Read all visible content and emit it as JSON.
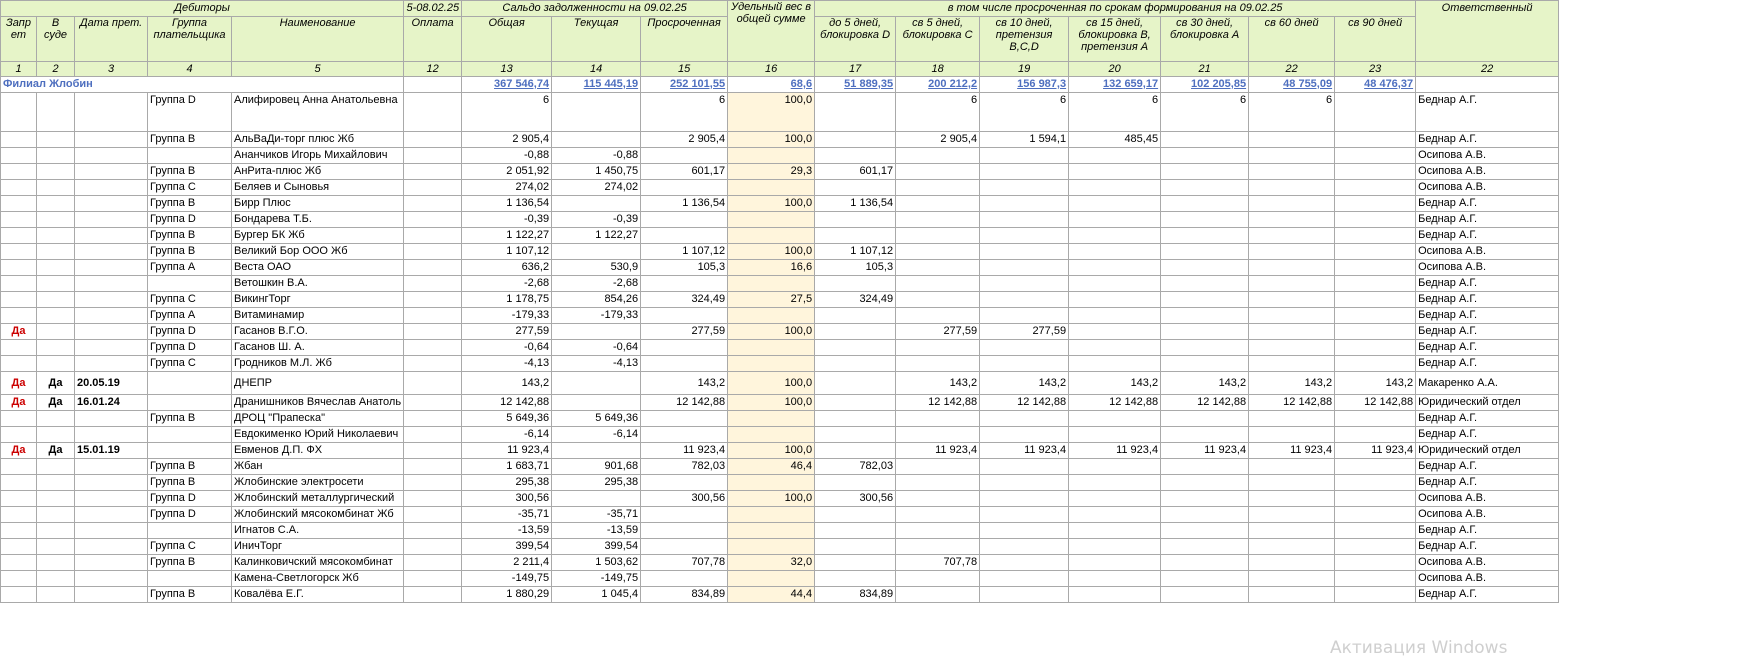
{
  "header": {
    "debitors": "Дебиторы",
    "payment_period": "5-08.02.25",
    "saldo": "Сальдо задолженности на 09.02.25",
    "weight": "Удельный вес в общей сумме",
    "overdue_terms": "в том числе просроченная по срокам формирования на 09.02.25",
    "responsible": "Ответственный"
  },
  "columns": {
    "ban": "Запр ет",
    "court": "В суде",
    "claim_date": "Дата прет.",
    "payer_group": "Группа плательщика",
    "name": "Наименование",
    "payment": "Оплата",
    "total": "Общая",
    "current": "Текущая",
    "overdue": "Просроченная",
    "d5": "до 5 дней, блокировка D",
    "o5": "св 5 дней, блокировка С",
    "o10": "св 10 дней, претензия В,С,D",
    "o15": "св 15 дней, блокировка В, претензия А",
    "o30": "св 30 дней, блокировка А",
    "o60": "св 60 дней",
    "o90": "св 90 дней"
  },
  "col_numbers": [
    "1",
    "2",
    "3",
    "4",
    "5",
    "12",
    "13",
    "14",
    "15",
    "16",
    "17",
    "18",
    "19",
    "20",
    "21",
    "22",
    "23",
    "22"
  ],
  "branch": {
    "name": "Филиал Жлобин",
    "total": "367 546,74",
    "current": "115 445,19",
    "overdue": "252 101,55",
    "weight": "68,6",
    "d5": "51 889,35",
    "o5": "200 212,2",
    "o10": "156 987,3",
    "o15": "132 659,17",
    "o30": "102 205,85",
    "o60": "48 755,09",
    "o90": "48 476,37"
  },
  "rows": [
    {
      "ban": "",
      "court": "",
      "date": "",
      "group": "Группа D",
      "name": "Алифировец Анна Анатольевна",
      "total": "6",
      "current": "",
      "overdue": "6",
      "weight": "100,0",
      "d5": "",
      "o5": "6",
      "o10": "6",
      "o15": "6",
      "o30": "6",
      "o60": "6",
      "o90": "",
      "resp": "Беднар А.Г.",
      "h": "tall"
    },
    {
      "ban": "",
      "court": "",
      "date": "",
      "group": "Группа В",
      "name": "АльВаДи-торг плюс Жб",
      "total": "2 905,4",
      "current": "",
      "overdue": "2 905,4",
      "weight": "100,0",
      "d5": "",
      "o5": "2 905,4",
      "o10": "1 594,1",
      "o15": "485,45",
      "o30": "",
      "o60": "",
      "o90": "",
      "resp": "Беднар А.Г."
    },
    {
      "ban": "",
      "court": "",
      "date": "",
      "group": "",
      "name": "Ананчиков Игорь Михайлович",
      "total": "-0,88",
      "current": "-0,88",
      "overdue": "",
      "weight": "",
      "d5": "",
      "o5": "",
      "o10": "",
      "o15": "",
      "o30": "",
      "o60": "",
      "o90": "",
      "resp": "Осипова А.В."
    },
    {
      "ban": "",
      "court": "",
      "date": "",
      "group": "Группа В",
      "name": "АнРита-плюс Жб",
      "total": "2 051,92",
      "current": "1 450,75",
      "overdue": "601,17",
      "weight": "29,3",
      "d5": "601,17",
      "o5": "",
      "o10": "",
      "o15": "",
      "o30": "",
      "o60": "",
      "o90": "",
      "resp": "Осипова А.В."
    },
    {
      "ban": "",
      "court": "",
      "date": "",
      "group": "Группа С",
      "name": "Беляев и Сыновья",
      "total": "274,02",
      "current": "274,02",
      "overdue": "",
      "weight": "",
      "d5": "",
      "o5": "",
      "o10": "",
      "o15": "",
      "o30": "",
      "o60": "",
      "o90": "",
      "resp": "Осипова А.В."
    },
    {
      "ban": "",
      "court": "",
      "date": "",
      "group": "Группа В",
      "name": "Бирр Плюс",
      "total": "1 136,54",
      "current": "",
      "overdue": "1 136,54",
      "weight": "100,0",
      "d5": "1 136,54",
      "o5": "",
      "o10": "",
      "o15": "",
      "o30": "",
      "o60": "",
      "o90": "",
      "resp": "Беднар А.Г."
    },
    {
      "ban": "",
      "court": "",
      "date": "",
      "group": "Группа D",
      "name": "Бондарева Т.Б.",
      "total": "-0,39",
      "current": "-0,39",
      "overdue": "",
      "weight": "",
      "d5": "",
      "o5": "",
      "o10": "",
      "o15": "",
      "o30": "",
      "o60": "",
      "o90": "",
      "resp": "Беднар А.Г."
    },
    {
      "ban": "",
      "court": "",
      "date": "",
      "group": "Группа В",
      "name": "Бургер БК Жб",
      "total": "1 122,27",
      "current": "1 122,27",
      "overdue": "",
      "weight": "",
      "d5": "",
      "o5": "",
      "o10": "",
      "o15": "",
      "o30": "",
      "o60": "",
      "o90": "",
      "resp": "Беднар А.Г."
    },
    {
      "ban": "",
      "court": "",
      "date": "",
      "group": "Группа В",
      "name": "Великий Бор  ООО Жб",
      "total": "1 107,12",
      "current": "",
      "overdue": "1 107,12",
      "weight": "100,0",
      "d5": "1 107,12",
      "o5": "",
      "o10": "",
      "o15": "",
      "o30": "",
      "o60": "",
      "o90": "",
      "resp": "Осипова А.В."
    },
    {
      "ban": "",
      "court": "",
      "date": "",
      "group": "Группа А",
      "name": "Веста ОАО",
      "total": "636,2",
      "current": "530,9",
      "overdue": "105,3",
      "weight": "16,6",
      "d5": "105,3",
      "o5": "",
      "o10": "",
      "o15": "",
      "o30": "",
      "o60": "",
      "o90": "",
      "resp": "Осипова А.В."
    },
    {
      "ban": "",
      "court": "",
      "date": "",
      "group": "",
      "name": "Ветошкин В.А.",
      "total": "-2,68",
      "current": "-2,68",
      "overdue": "",
      "weight": "",
      "d5": "",
      "o5": "",
      "o10": "",
      "o15": "",
      "o30": "",
      "o60": "",
      "o90": "",
      "resp": "Беднар А.Г."
    },
    {
      "ban": "",
      "court": "",
      "date": "",
      "group": "Группа С",
      "name": "ВикингТорг",
      "total": "1 178,75",
      "current": "854,26",
      "overdue": "324,49",
      "weight": "27,5",
      "d5": "324,49",
      "o5": "",
      "o10": "",
      "o15": "",
      "o30": "",
      "o60": "",
      "o90": "",
      "resp": "Беднар А.Г."
    },
    {
      "ban": "",
      "court": "",
      "date": "",
      "group": "Группа А",
      "name": "Витаминамир",
      "total": "-179,33",
      "current": "-179,33",
      "overdue": "",
      "weight": "",
      "d5": "",
      "o5": "",
      "o10": "",
      "o15": "",
      "o30": "",
      "o60": "",
      "o90": "",
      "resp": "Беднар А.Г."
    },
    {
      "ban": "Да",
      "court": "",
      "date": "",
      "group": "Группа D",
      "name": "Гасанов В.Г.О.",
      "total": "277,59",
      "current": "",
      "overdue": "277,59",
      "weight": "100,0",
      "d5": "",
      "o5": "277,59",
      "o10": "277,59",
      "o15": "",
      "o30": "",
      "o60": "",
      "o90": "",
      "resp": "Беднар А.Г."
    },
    {
      "ban": "",
      "court": "",
      "date": "",
      "group": "Группа D",
      "name": "Гасанов Ш. А.",
      "total": "-0,64",
      "current": "-0,64",
      "overdue": "",
      "weight": "",
      "d5": "",
      "o5": "",
      "o10": "",
      "o15": "",
      "o30": "",
      "o60": "",
      "o90": "",
      "resp": "Беднар А.Г."
    },
    {
      "ban": "",
      "court": "",
      "date": "",
      "group": "Группа С",
      "name": "Гродников М.Л. Жб",
      "total": "-4,13",
      "current": "-4,13",
      "overdue": "",
      "weight": "",
      "d5": "",
      "o5": "",
      "o10": "",
      "o15": "",
      "o30": "",
      "o60": "",
      "o90": "",
      "resp": "Беднар А.Г."
    },
    {
      "ban": "Да",
      "court": "Да",
      "date": "20.05.19",
      "group": "",
      "name": "ДНЕПР",
      "total": "143,2",
      "current": "",
      "overdue": "143,2",
      "weight": "100,0",
      "d5": "",
      "o5": "143,2",
      "o10": "143,2",
      "o15": "143,2",
      "o30": "143,2",
      "o60": "143,2",
      "o90": "143,2",
      "resp": "Макаренко А.А.",
      "h": "mid"
    },
    {
      "ban": "Да",
      "court": "Да",
      "date": "16.01.24",
      "group": "",
      "name": "Дранишников Вячеслав Анатоль",
      "total": "12 142,88",
      "current": "",
      "overdue": "12 142,88",
      "weight": "100,0",
      "d5": "",
      "o5": "12 142,88",
      "o10": "12 142,88",
      "o15": "12 142,88",
      "o30": "12 142,88",
      "o60": "12 142,88",
      "o90": "12 142,88",
      "resp": "Юридический отдел"
    },
    {
      "ban": "",
      "court": "",
      "date": "",
      "group": "Группа В",
      "name": "ДРОЦ \"Прапеска\"",
      "total": "5 649,36",
      "current": "5 649,36",
      "overdue": "",
      "weight": "",
      "d5": "",
      "o5": "",
      "o10": "",
      "o15": "",
      "o30": "",
      "o60": "",
      "o90": "",
      "resp": "Беднар А.Г."
    },
    {
      "ban": "",
      "court": "",
      "date": "",
      "group": "",
      "name": "Евдокименко Юрий Николаевич",
      "total": "-6,14",
      "current": "-6,14",
      "overdue": "",
      "weight": "",
      "d5": "",
      "o5": "",
      "o10": "",
      "o15": "",
      "o30": "",
      "o60": "",
      "o90": "",
      "resp": "Беднар А.Г."
    },
    {
      "ban": "Да",
      "court": "Да",
      "date": "15.01.19",
      "group": "",
      "name": "Евменов Д.П. ФХ",
      "total": "11 923,4",
      "current": "",
      "overdue": "11 923,4",
      "weight": "100,0",
      "d5": "",
      "o5": "11 923,4",
      "o10": "11 923,4",
      "o15": "11 923,4",
      "o30": "11 923,4",
      "o60": "11 923,4",
      "o90": "11 923,4",
      "resp": "Юридический отдел"
    },
    {
      "ban": "",
      "court": "",
      "date": "",
      "group": "Группа В",
      "name": "Жбан",
      "total": "1 683,71",
      "current": "901,68",
      "overdue": "782,03",
      "weight": "46,4",
      "d5": "782,03",
      "o5": "",
      "o10": "",
      "o15": "",
      "o30": "",
      "o60": "",
      "o90": "",
      "resp": "Беднар А.Г."
    },
    {
      "ban": "",
      "court": "",
      "date": "",
      "group": "Группа В",
      "name": "Жлобинские электросети",
      "total": "295,38",
      "current": "295,38",
      "overdue": "",
      "weight": "",
      "d5": "",
      "o5": "",
      "o10": "",
      "o15": "",
      "o30": "",
      "o60": "",
      "o90": "",
      "resp": "Беднар А.Г."
    },
    {
      "ban": "",
      "court": "",
      "date": "",
      "group": "Группа D",
      "name": "Жлобинский металлургический",
      "total": "300,56",
      "current": "",
      "overdue": "300,56",
      "weight": "100,0",
      "d5": "300,56",
      "o5": "",
      "o10": "",
      "o15": "",
      "o30": "",
      "o60": "",
      "o90": "",
      "resp": "Осипова А.В."
    },
    {
      "ban": "",
      "court": "",
      "date": "",
      "group": "Группа D",
      "name": "Жлобинский мясокомбинат Жб",
      "total": "-35,71",
      "current": "-35,71",
      "overdue": "",
      "weight": "",
      "d5": "",
      "o5": "",
      "o10": "",
      "o15": "",
      "o30": "",
      "o60": "",
      "o90": "",
      "resp": "Осипова А.В."
    },
    {
      "ban": "",
      "court": "",
      "date": "",
      "group": "",
      "name": "Игнатов С.А.",
      "total": "-13,59",
      "current": "-13,59",
      "overdue": "",
      "weight": "",
      "d5": "",
      "o5": "",
      "o10": "",
      "o15": "",
      "o30": "",
      "o60": "",
      "o90": "",
      "resp": "Беднар А.Г."
    },
    {
      "ban": "",
      "court": "",
      "date": "",
      "group": "Группа С",
      "name": "ИничТорг",
      "total": "399,54",
      "current": "399,54",
      "overdue": "",
      "weight": "",
      "d5": "",
      "o5": "",
      "o10": "",
      "o15": "",
      "o30": "",
      "o60": "",
      "o90": "",
      "resp": "Беднар А.Г."
    },
    {
      "ban": "",
      "court": "",
      "date": "",
      "group": "Группа В",
      "name": "Калинковичский мясокомбинат",
      "total": "2 211,4",
      "current": "1 503,62",
      "overdue": "707,78",
      "weight": "32,0",
      "d5": "",
      "o5": "707,78",
      "o10": "",
      "o15": "",
      "o30": "",
      "o60": "",
      "o90": "",
      "resp": "Осипова А.В."
    },
    {
      "ban": "",
      "court": "",
      "date": "",
      "group": "",
      "name": "Камена-Светлогорск Жб",
      "total": "-149,75",
      "current": "-149,75",
      "overdue": "",
      "weight": "",
      "d5": "",
      "o5": "",
      "o10": "",
      "o15": "",
      "o30": "",
      "o60": "",
      "o90": "",
      "resp": "Осипова А.В."
    },
    {
      "ban": "",
      "court": "",
      "date": "",
      "group": "Группа В",
      "name": "Ковалёва Е.Г.",
      "total": "1 880,29",
      "current": "1 045,4",
      "overdue": "834,89",
      "weight": "44,4",
      "d5": "834,89",
      "o5": "",
      "o10": "",
      "o15": "",
      "o30": "",
      "o60": "",
      "o90": "",
      "resp": "Беднар А.Г."
    }
  ],
  "watermark": "Активация Windows"
}
